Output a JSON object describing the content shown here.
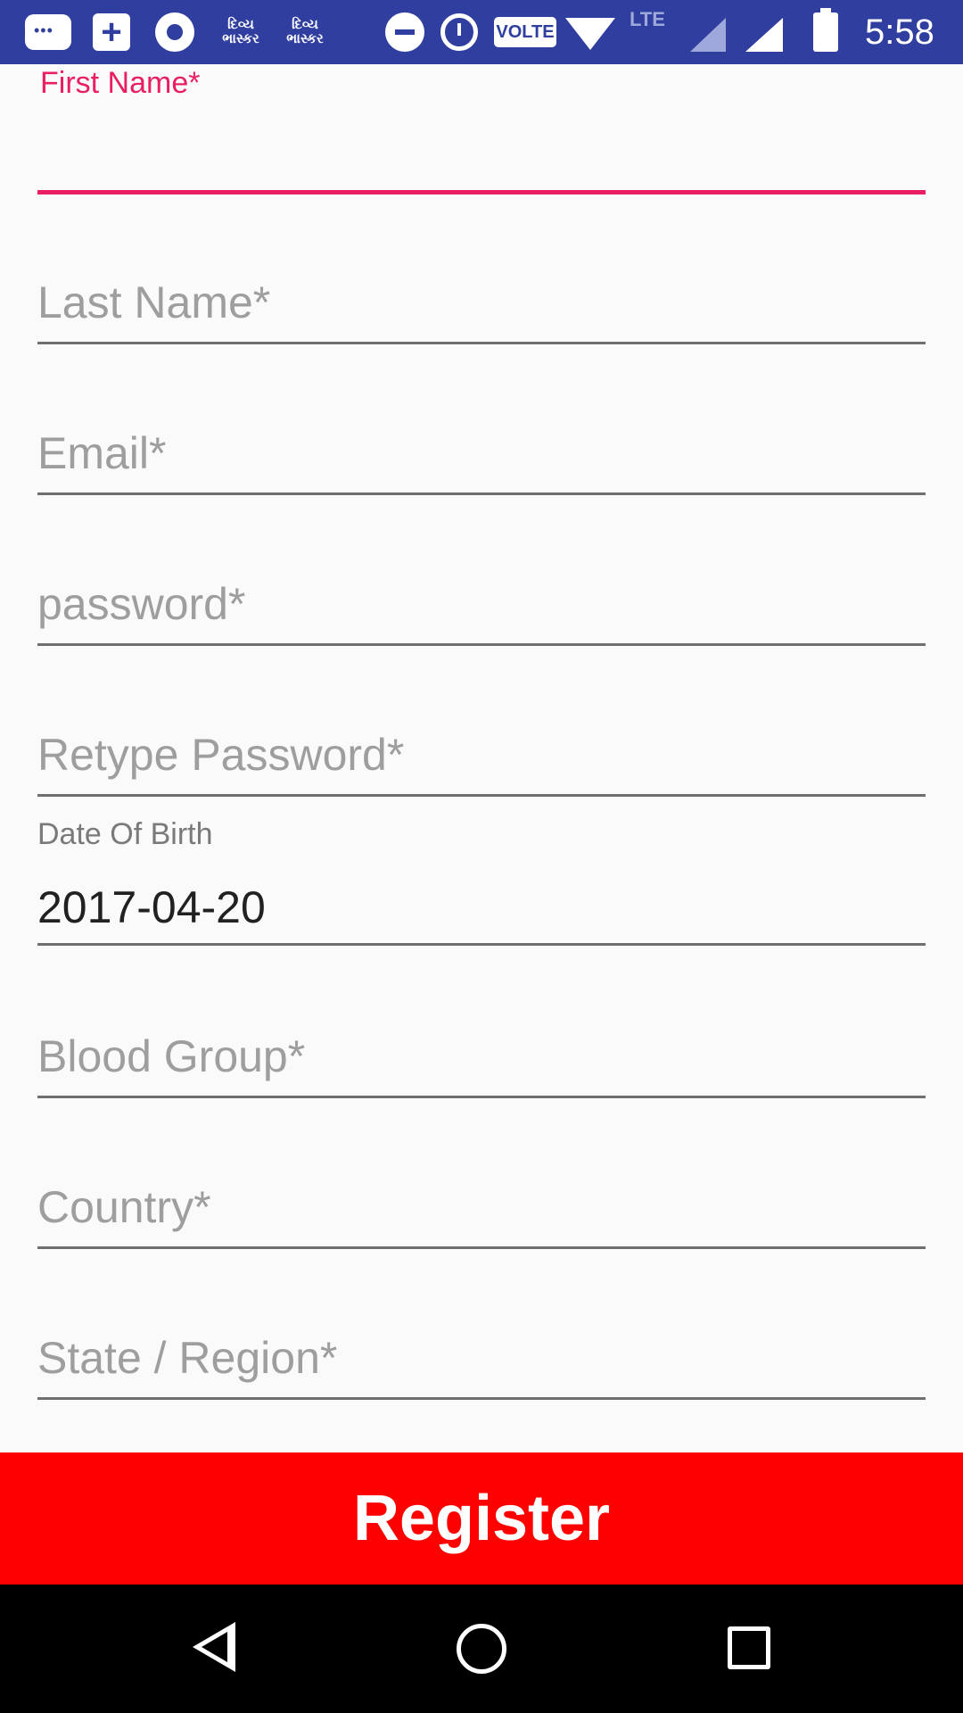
{
  "status_bar": {
    "icons": [
      "messages-icon",
      "plus-app-icon",
      "chrome-icon",
      "divya-bhaskar-icon",
      "divya-bhaskar-icon",
      "do-not-disturb-icon",
      "alarm-icon",
      "volte-icon",
      "wifi-icon",
      "lte-icon",
      "signal-icon",
      "signal-icon",
      "battery-charging-icon"
    ],
    "guj_app_1": "દિવ્ય ભાસ્કર",
    "guj_app_2": "દિવ્ય ભાસ્કર",
    "volte": "VOLTE",
    "lte": "LTE",
    "time": "5:58",
    "background": "#303f9f"
  },
  "form": {
    "first_name": {
      "label": "First Name*",
      "value": ""
    },
    "last_name": {
      "placeholder": "Last Name*"
    },
    "email": {
      "placeholder": "Email*"
    },
    "password": {
      "placeholder": "password*"
    },
    "retype_password": {
      "placeholder": "Retype Password*"
    },
    "date_of_birth": {
      "label": "Date Of Birth",
      "value": "2017-04-20"
    },
    "blood_group": {
      "placeholder": "Blood Group*"
    },
    "country": {
      "placeholder": "Country*"
    },
    "state_region": {
      "placeholder": "State / Region*"
    }
  },
  "register_button": {
    "label": "Register",
    "color": "#ff0000"
  },
  "nav_bar": {
    "icons": [
      "back-icon",
      "home-icon",
      "recent-apps-icon"
    ]
  },
  "colors": {
    "accent": "#e91e63",
    "underline": "#6f6f6f",
    "hint": "#9e9e9e"
  }
}
